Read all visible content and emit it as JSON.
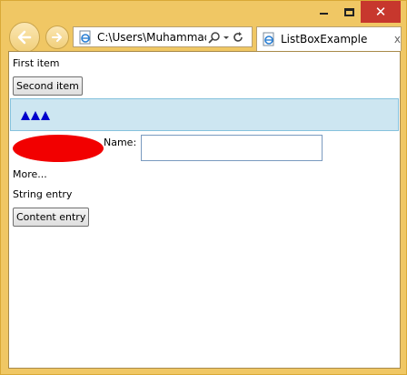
{
  "window": {
    "frame_color": "#f0c764",
    "close_color": "#c7372d",
    "close_glyph": "✕"
  },
  "address_bar": {
    "value": "C:\\Users\\Muhammad."
  },
  "tab": {
    "title": "ListBoxExample",
    "close_glyph": "x"
  },
  "listbox": {
    "first_item": "First item",
    "second_item": "Second item",
    "selected_row_color": "#cde6f1",
    "triangle_color": "#0000cc",
    "ellipse_color": "#f20000",
    "name_label": "Name:",
    "name_value": "",
    "more_item": "More...",
    "string_entry": "String entry",
    "content_entry": "Content entry"
  }
}
